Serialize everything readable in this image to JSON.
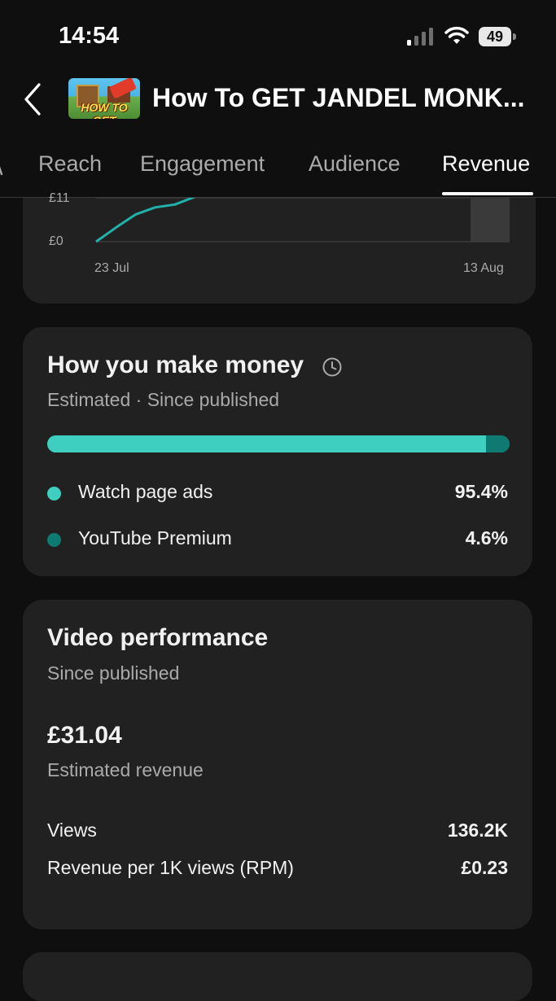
{
  "status_bar": {
    "time": "14:54",
    "battery": "49"
  },
  "header": {
    "title": "How To GET JANDEL MONK...",
    "thumbnail_text": "HOW TO GET"
  },
  "tabs": [
    {
      "label": "Reach",
      "active": false
    },
    {
      "label": "Engagement",
      "active": false
    },
    {
      "label": "Audience",
      "active": false
    },
    {
      "label": "Revenue",
      "active": true
    }
  ],
  "chart_data": {
    "type": "line",
    "y_tick_labels": [
      "£0",
      "£11"
    ],
    "x_tick_labels": [
      "23 Jul",
      "13 Aug"
    ],
    "series": [
      {
        "values": [
          0,
          3.5,
          6.8,
          8.6,
          9.3,
          11.2,
          14.5
        ]
      }
    ],
    "ylim": [
      0,
      11
    ],
    "grid": true,
    "color": "#20b2aa"
  },
  "money": {
    "title": "How you make money",
    "subtitle": "Estimated · Since published",
    "sources": [
      {
        "label": "Watch page ads",
        "value": "95.4%",
        "share": 0.954,
        "color": "#3ecfc0"
      },
      {
        "label": "YouTube Premium",
        "value": "4.6%",
        "share": 0.046,
        "color": "#0e7a72"
      }
    ]
  },
  "performance": {
    "title": "Video performance",
    "subtitle": "Since published",
    "revenue_value": "£31.04",
    "revenue_label": "Estimated revenue",
    "rows": [
      {
        "label": "Views",
        "value": "136.2K"
      },
      {
        "label": "Revenue per 1K views (RPM)",
        "value": "£0.23"
      }
    ]
  }
}
